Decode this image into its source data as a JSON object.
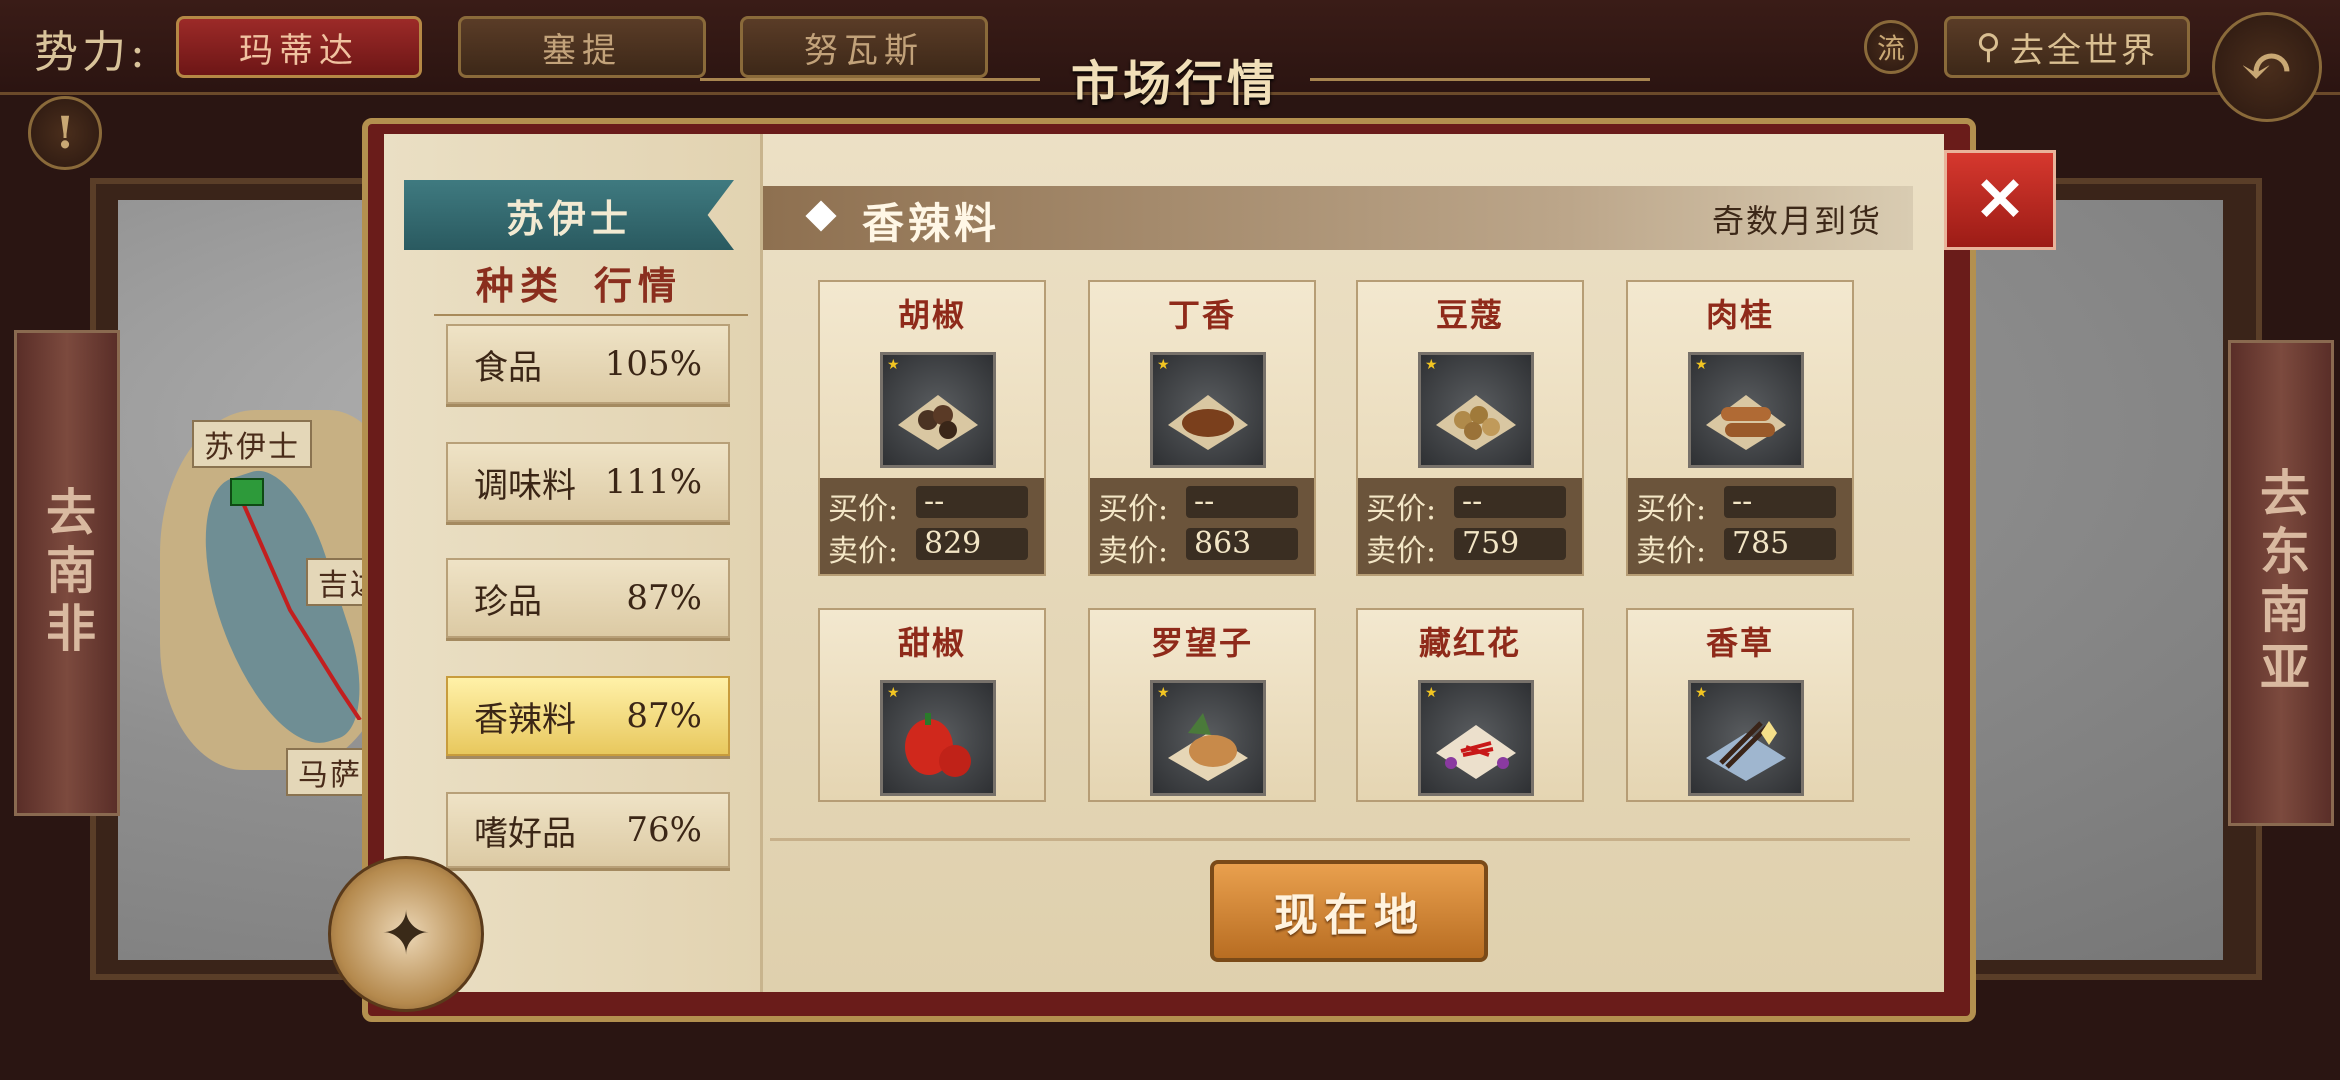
{
  "top_bar": {
    "faction_label": "势力:",
    "faction_tabs": [
      {
        "label": "玛蒂达",
        "active": true
      },
      {
        "label": "塞提",
        "active": false
      },
      {
        "label": "努瓦斯",
        "active": false
      }
    ],
    "flow_button": "流",
    "search_button": "去全世界",
    "page_title": "市场行情"
  },
  "map": {
    "labels": [
      "苏伊士",
      "吉达",
      "马萨"
    ],
    "left_nav": "去南非",
    "right_nav": "去东南亚"
  },
  "sidebar": {
    "city": "苏伊士",
    "col_type": "种类",
    "col_market": "行情",
    "categories": [
      {
        "name": "食品",
        "pct": "105%"
      },
      {
        "name": "调味料",
        "pct": "111%"
      },
      {
        "name": "珍品",
        "pct": "87%"
      },
      {
        "name": "香辣料",
        "pct": "87%"
      },
      {
        "name": "嗜好品",
        "pct": "76%"
      }
    ]
  },
  "goods": {
    "category": "香辣料",
    "note": "奇数月到货",
    "buy_label": "买价:",
    "sell_label": "卖价:",
    "items": [
      {
        "name": "胡椒",
        "buy": "--",
        "sell": "829"
      },
      {
        "name": "丁香",
        "buy": "--",
        "sell": "863"
      },
      {
        "name": "豆蔻",
        "buy": "--",
        "sell": "759"
      },
      {
        "name": "肉桂",
        "buy": "--",
        "sell": "785"
      },
      {
        "name": "甜椒"
      },
      {
        "name": "罗望子"
      },
      {
        "name": "藏红花"
      },
      {
        "name": "香草"
      }
    ]
  },
  "now_button": "现在地",
  "close_symbol": "✕",
  "colors": {
    "accent_red": "#9c2a28",
    "ribbon_teal": "#3f7a80",
    "gold_button": "#d08a3a"
  }
}
